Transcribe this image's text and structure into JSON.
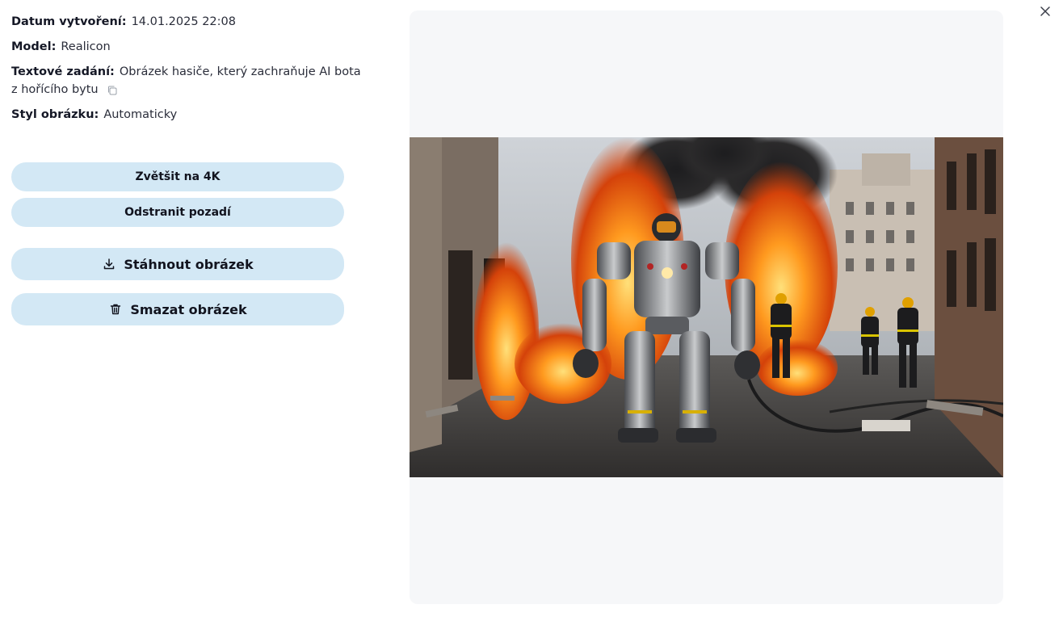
{
  "meta": {
    "created_label": "Datum vytvoření:",
    "created_value": "14.01.2025 22:08",
    "model_label": "Model:",
    "model_value": "Realicon",
    "prompt_label": "Textové zadání:",
    "prompt_value": "Obrázek hasiče, který zachraňuje AI bota z hořícího bytu",
    "style_label": "Styl obrázku:",
    "style_value": "Automaticky"
  },
  "actions": {
    "upscale_label": "Zvětšit na 4K",
    "remove_bg_label": "Odstranit pozadí",
    "download_label": "Stáhnout obrázek",
    "delete_label": "Smazat obrázek"
  },
  "icons": {
    "copy": "copy-icon",
    "download": "download-icon",
    "delete": "trash-icon",
    "close": "close-icon"
  },
  "colors": {
    "button_bg": "#d3e8f5",
    "panel_bg": "#f6f7f9"
  }
}
